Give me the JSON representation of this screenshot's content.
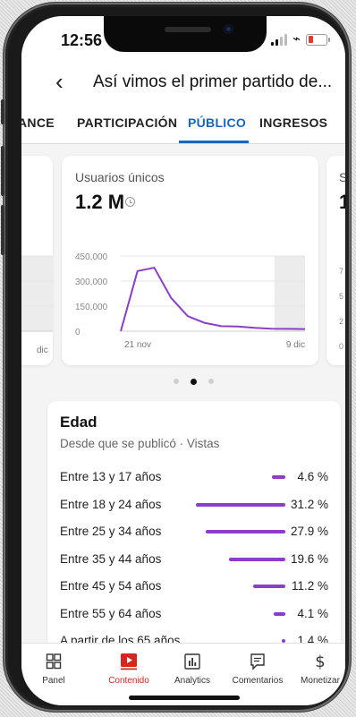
{
  "status_bar": {
    "time": "12:56"
  },
  "header": {
    "title": "Así vimos el primer partido de..."
  },
  "tabs": [
    {
      "label": "ANCE"
    },
    {
      "label": "PARTICIPACIÓN"
    },
    {
      "label": "PÚBLICO",
      "active": true
    },
    {
      "label": "INGRESOS"
    }
  ],
  "metric_card": {
    "label": "Usuarios únicos",
    "value": "1.2 M",
    "chart_data": {
      "type": "line",
      "x_tick_labels": [
        "21 nov",
        "9 dic"
      ],
      "y_tick_labels": [
        "450,000",
        "300,000",
        "150,000",
        "0"
      ],
      "ylim": [
        0,
        450000
      ],
      "x": [
        0,
        1,
        2,
        3,
        4,
        5,
        6,
        7,
        8,
        9,
        10,
        11
      ],
      "values": [
        0,
        360000,
        380000,
        200000,
        90000,
        50000,
        30000,
        28000,
        20000,
        15000,
        14000,
        13000
      ],
      "shaded_tail": true,
      "line_color": "#8b3ec9"
    }
  },
  "left_peek": {
    "tick_label": "dic"
  },
  "right_peek": {
    "label": "S",
    "value": "1",
    "ticks": [
      "7",
      "5",
      "2",
      "0"
    ]
  },
  "carousel": {
    "count": 3,
    "active_index": 1
  },
  "age_card": {
    "title": "Edad",
    "subtitle": "Desde que se publicó · Vistas",
    "rows": [
      {
        "label": "Entre 13 y 17 años",
        "value": "4.6 %",
        "percent": 4.6
      },
      {
        "label": "Entre 18 y 24 años",
        "value": "31.2 %",
        "percent": 31.2
      },
      {
        "label": "Entre 25 y 34 años",
        "value": "27.9 %",
        "percent": 27.9
      },
      {
        "label": "Entre 35 y 44 años",
        "value": "19.6 %",
        "percent": 19.6
      },
      {
        "label": "Entre 45 y 54 años",
        "value": "11.2 %",
        "percent": 11.2
      },
      {
        "label": "Entre 55 y 64 años",
        "value": "4.1 %",
        "percent": 4.1
      },
      {
        "label": "A partir de los 65 años",
        "value": "1.4 %",
        "percent": 1.4
      }
    ],
    "bar_color": "#8b3ec9"
  },
  "bottom_nav": [
    {
      "label": "Panel",
      "icon": "dashboard-icon"
    },
    {
      "label": "Contenido",
      "icon": "content-play-icon",
      "active": true
    },
    {
      "label": "Analytics",
      "icon": "analytics-icon"
    },
    {
      "label": "Comentarios",
      "icon": "comments-icon"
    },
    {
      "label": "Monetizar",
      "icon": "dollar-icon"
    }
  ]
}
